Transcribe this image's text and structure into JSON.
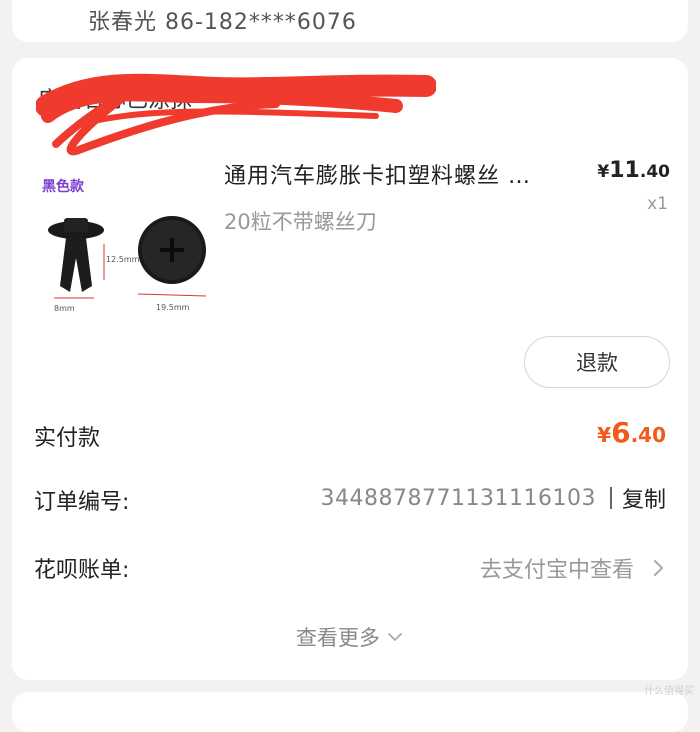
{
  "address_card": {
    "contact": "张春光 86-182****6076"
  },
  "order_card": {
    "shop_name": "店铺名称已涂抹",
    "product": {
      "variant_tag": "黑色款",
      "title": "通用汽车膨胀卡扣塑料螺丝 …",
      "spec": "20粒不带螺丝刀",
      "price_symbol": "¥",
      "price_int": "11",
      "price_dec": ".40",
      "quantity": "x1",
      "image_labels": {
        "dim_a": "12.5mm",
        "dim_b": "8mm",
        "dim_c": "19.5mm"
      }
    },
    "refund_label": "退款",
    "paid": {
      "label": "实付款",
      "symbol": "¥",
      "int": "6",
      "dec": ".40"
    },
    "order_number": {
      "label": "订单编号:",
      "value": "3448878771131116103",
      "copy_label": "复制"
    },
    "huabei": {
      "label": "花呗账单:",
      "link": "去支付宝中查看"
    },
    "view_more": "查看更多"
  },
  "watermark": "什么值得买",
  "colors": {
    "accent_orange": "#f05a1a",
    "variant_purple": "#7a3fd0",
    "redact_red": "#f03a2e"
  }
}
